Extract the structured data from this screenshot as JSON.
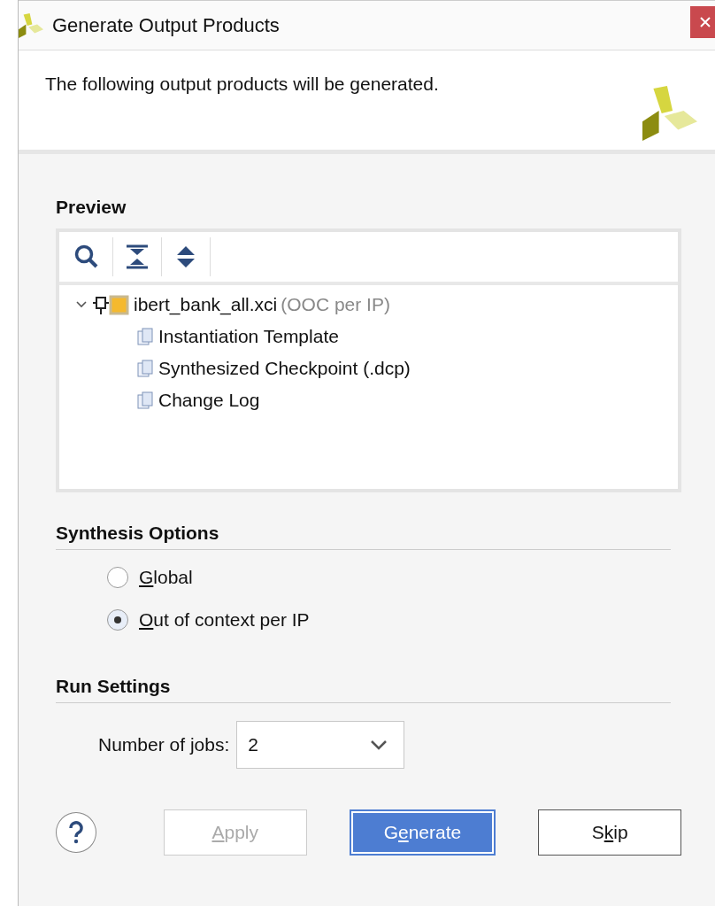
{
  "window": {
    "title": "Generate Output Products"
  },
  "header": {
    "message": "The following output products will be generated."
  },
  "preview": {
    "title": "Preview",
    "tree": [
      {
        "name": "ibert_bank_all.xci",
        "note": "(OOC per IP)",
        "expanded": true,
        "children": [
          {
            "name": "Instantiation Template"
          },
          {
            "name": "Synthesized Checkpoint (.dcp)"
          },
          {
            "name": "Change Log"
          }
        ]
      }
    ]
  },
  "synthesis_options": {
    "title": "Synthesis Options",
    "options": [
      {
        "key": "G",
        "after": "lobal",
        "selected": false
      },
      {
        "key": "O",
        "after": "ut of context per IP",
        "selected": true
      }
    ]
  },
  "run_settings": {
    "title": "Run Settings",
    "jobs": {
      "before": "Number of ",
      "key": "j",
      "after": "obs:",
      "value": "2"
    }
  },
  "buttons": [
    {
      "key": "A",
      "after": "pply",
      "kind": "normal",
      "disabled": true
    },
    {
      "before": "G",
      "key": "e",
      "after": "nerate",
      "kind": "primary",
      "disabled": false
    },
    {
      "before": "S",
      "key": "k",
      "after": "ip",
      "kind": "normal",
      "disabled": false
    }
  ]
}
